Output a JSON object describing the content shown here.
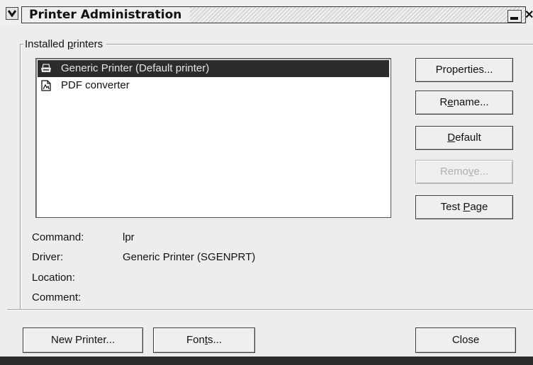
{
  "window": {
    "title": "Printer Administration"
  },
  "printers_group": {
    "label_prefix": "Installed ",
    "label_accel": "p",
    "label_suffix": "rinters",
    "printers": [
      {
        "name": "Generic Printer (Default printer)",
        "selected": true,
        "icon": "printer-icon"
      },
      {
        "name": "PDF converter",
        "selected": false,
        "icon": "pdf-document-icon"
      }
    ]
  },
  "side_buttons": {
    "properties": "Properties...",
    "rename": {
      "pre": "R",
      "accel": "e",
      "post": "name..."
    },
    "default": {
      "pre": "",
      "accel": "D",
      "post": "efault"
    },
    "remove": {
      "pre": "Remo",
      "accel": "v",
      "post": "e...",
      "enabled": false
    },
    "test_page": {
      "pre": "Test ",
      "accel": "P",
      "post": "age"
    }
  },
  "details": {
    "command_label": "Command:",
    "command_value": "lpr",
    "driver_label": "Driver:",
    "driver_value": "Generic Printer (SGENPRT)",
    "location_label": "Location:",
    "location_value": "",
    "comment_label": "Comment:",
    "comment_value": ""
  },
  "bottom_buttons": {
    "new_printer": "New Printer...",
    "fonts": {
      "pre": "Fon",
      "accel": "t",
      "post": "s..."
    },
    "close": "Close"
  }
}
